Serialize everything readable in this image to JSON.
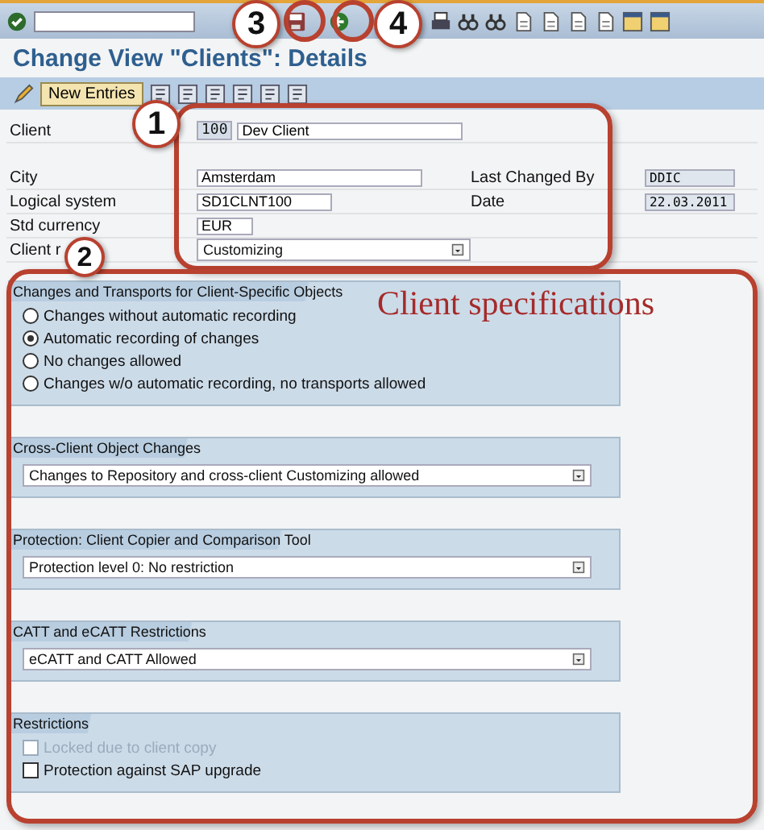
{
  "system_toolbar": {
    "icons": [
      {
        "kind": "check"
      },
      {
        "kind": "save"
      },
      {
        "kind": "back"
      },
      {
        "kind": "printer"
      },
      {
        "kind": "binoculars"
      },
      {
        "kind": "binoculars"
      },
      {
        "kind": "page"
      },
      {
        "kind": "page"
      },
      {
        "kind": "page"
      },
      {
        "kind": "page"
      },
      {
        "kind": "window"
      },
      {
        "kind": "window"
      }
    ]
  },
  "title": "Change View \"Clients\": Details",
  "app_toolbar": {
    "items": [
      {
        "kind": "pencil"
      },
      {
        "kind": "button",
        "label": "New Entries"
      },
      {
        "kind": "document"
      },
      {
        "kind": "document"
      },
      {
        "kind": "document"
      },
      {
        "kind": "document"
      },
      {
        "kind": "document"
      },
      {
        "kind": "document"
      }
    ]
  },
  "header_fields": [
    {
      "label": "Client",
      "code": "100",
      "value": "Dev Client"
    },
    {
      "label": "City",
      "value": "Amsterdam",
      "right_label": "Last Changed By",
      "right_value": "DDIC"
    },
    {
      "label": "Logical system",
      "value": "SD1CLNT100",
      "right_label": "Date",
      "right_value": "22.03.2011"
    },
    {
      "label": "Std currency",
      "value": "EUR"
    },
    {
      "label": "Client r",
      "value": "Customizing",
      "dropdown": true
    }
  ],
  "groups": [
    {
      "title": "Changes and Transports for Client-Specific Objects",
      "kind": "radios",
      "options": [
        {
          "label": "Changes without automatic recording",
          "selected": false
        },
        {
          "label": "Automatic recording of changes",
          "selected": true
        },
        {
          "label": "No changes allowed",
          "selected": false
        },
        {
          "label": "Changes w/o automatic recording, no transports allowed",
          "selected": false
        }
      ]
    },
    {
      "title": "Cross-Client Object Changes",
      "kind": "dropdown",
      "value": "Changes to Repository and cross-client Customizing allowed"
    },
    {
      "title": "Protection: Client Copier and Comparison Tool",
      "kind": "dropdown",
      "value": "Protection level 0: No restriction"
    },
    {
      "title": "CATT and eCATT Restrictions",
      "kind": "dropdown",
      "value": "eCATT and CATT Allowed"
    },
    {
      "title": "Restrictions",
      "kind": "checkboxes",
      "options": [
        {
          "label": "Locked due to client copy",
          "checked": false,
          "disabled": true
        },
        {
          "label": "Protection against SAP upgrade",
          "checked": false,
          "disabled": false
        }
      ]
    }
  ],
  "annotations": {
    "callouts": [
      "1",
      "2",
      "3",
      "4"
    ],
    "caption": "Client specifications"
  }
}
